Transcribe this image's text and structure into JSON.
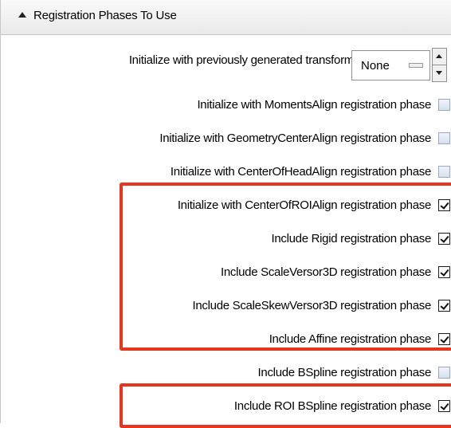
{
  "section": {
    "title": "Registration Phases To Use"
  },
  "transform_row": {
    "label": "Initialize with previously generated transform",
    "value": "None"
  },
  "phases": [
    {
      "label": "Initialize with MomentsAlign registration phase",
      "checked": false
    },
    {
      "label": "Initialize with GeometryCenterAlign registration phase",
      "checked": false
    },
    {
      "label": "Initialize with CenterOfHeadAlign registration phase",
      "checked": false
    },
    {
      "label": "Initialize with CenterOfROIAlign registration phase",
      "checked": true
    },
    {
      "label": "Include Rigid registration phase",
      "checked": true
    },
    {
      "label": "Include ScaleVersor3D registration phase",
      "checked": true
    },
    {
      "label": "Include ScaleSkewVersor3D registration phase",
      "checked": true
    },
    {
      "label": "Include Affine registration phase",
      "checked": true
    },
    {
      "label": "Include BSpline registration phase",
      "checked": false
    },
    {
      "label": "Include ROI BSpline registration phase",
      "checked": true
    }
  ],
  "colors": {
    "highlight": "#e8351f"
  }
}
